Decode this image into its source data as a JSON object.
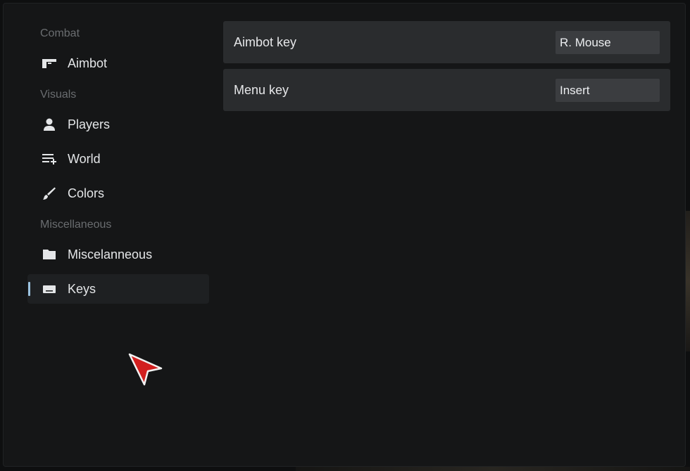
{
  "sidebar": {
    "sections": [
      {
        "label": "Combat",
        "items": [
          {
            "label": "Aimbot",
            "icon": "gun-icon"
          }
        ]
      },
      {
        "label": "Visuals",
        "items": [
          {
            "label": "Players",
            "icon": "person-icon"
          },
          {
            "label": "World",
            "icon": "playlist-add-icon"
          },
          {
            "label": "Colors",
            "icon": "brush-icon"
          }
        ]
      },
      {
        "label": "Miscellaneous",
        "items": [
          {
            "label": "Miscelanneous",
            "icon": "folder-icon"
          },
          {
            "label": "Keys",
            "icon": "keyboard-icon",
            "active": true
          }
        ]
      }
    ]
  },
  "keys": {
    "rows": [
      {
        "label": "Aimbot key",
        "value": "R. Mouse"
      },
      {
        "label": "Menu key",
        "value": "Insert"
      }
    ]
  },
  "colors": {
    "accent": "#9cc3e0",
    "cursor": "#d21f1f"
  }
}
